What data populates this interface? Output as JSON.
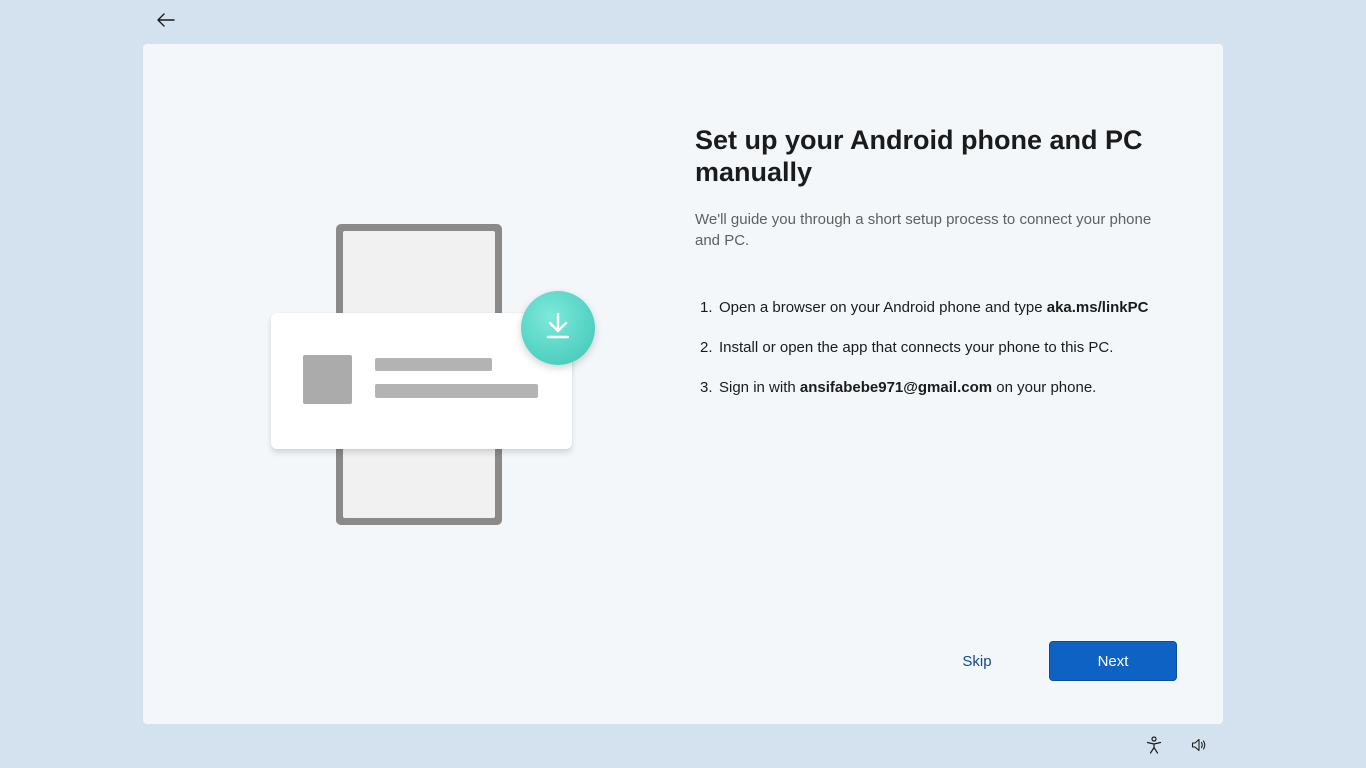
{
  "header": {
    "back_icon": "arrow-left-icon"
  },
  "main": {
    "title": "Set up your Android phone and PC manually",
    "subtitle": "We'll guide you through a short setup process to connect your phone and PC.",
    "steps": [
      {
        "number": "1.",
        "text_before": "Open a browser on your Android phone and type ",
        "bold": "aka.ms/linkPC",
        "text_after": ""
      },
      {
        "number": "2.",
        "text_before": "Install or open the app that connects your phone to this PC.",
        "bold": "",
        "text_after": ""
      },
      {
        "number": "3.",
        "text_before": "Sign in with ",
        "bold": "ansifabebe971@gmail.com",
        "text_after": " on your phone."
      }
    ],
    "illustration": {
      "badge_icon": "download-icon",
      "badge_color": "#4fd0c0"
    }
  },
  "footer": {
    "skip_label": "Skip",
    "next_label": "Next",
    "accent": "#0e62c4"
  },
  "tray": {
    "accessibility_icon": "accessibility-icon",
    "volume_icon": "volume-icon"
  }
}
